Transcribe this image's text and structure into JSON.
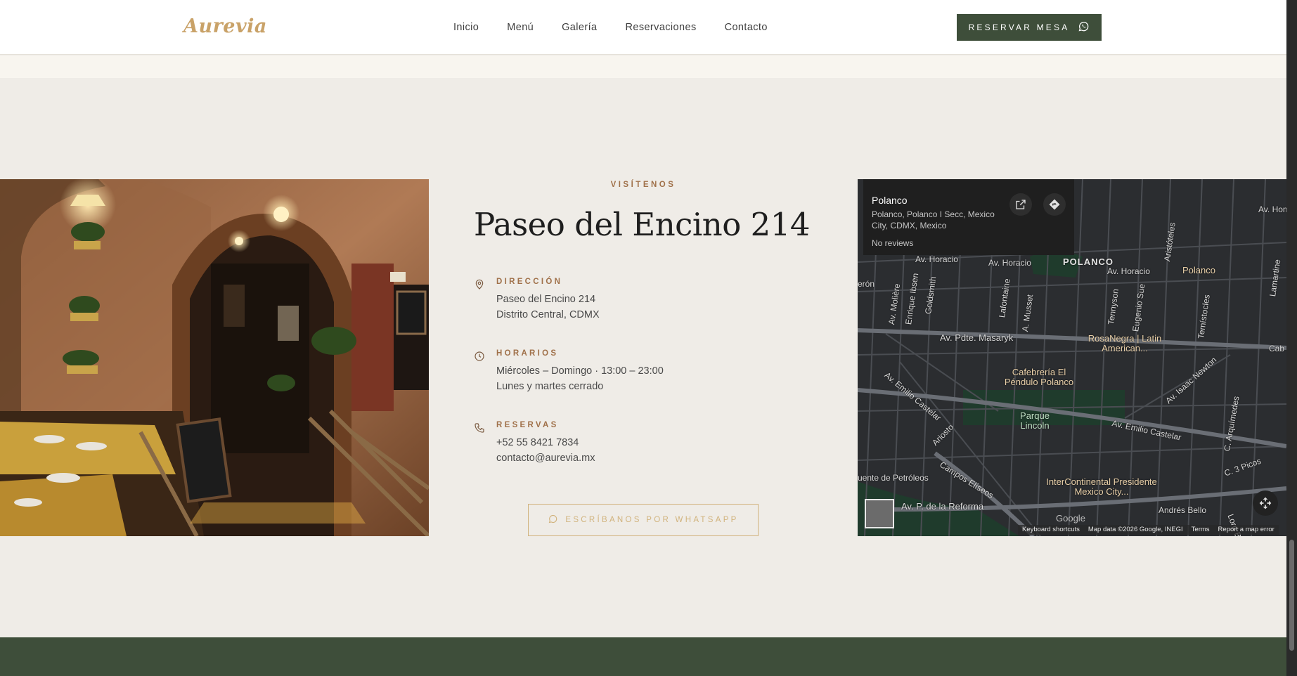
{
  "header": {
    "logo": "Aurevia",
    "nav": [
      "Inicio",
      "Menú",
      "Galería",
      "Reservaciones",
      "Contacto"
    ],
    "cta_label": "RESERVAR MESA"
  },
  "visit": {
    "eyebrow": "VISÍTENOS",
    "title": "Paseo del Encino 214",
    "direccion": {
      "label": "DIRECCIÓN",
      "lines": [
        "Paseo del Encino 214",
        "Distrito Central, CDMX"
      ]
    },
    "horarios": {
      "label": "HORARIOS",
      "lines": [
        "Miércoles – Domingo · 13:00 – 23:00",
        "Lunes y martes cerrado"
      ]
    },
    "reservas": {
      "label": "RESERVAS",
      "lines": [
        "+52 55 8421 7834",
        "contacto@aurevia.mx"
      ]
    },
    "whatsapp_button": "ESCRÍBANOS POR WHATSAPP"
  },
  "map": {
    "place_name": "Polanco",
    "place_address": "Polanco, Polanco I Secc, Mexico City, CDMX, Mexico",
    "reviews": "No reviews",
    "labels": {
      "av_horacio_1": "Av. Horacio",
      "av_horacio_2": "Av. Horacio",
      "av_horacio_3": "Av. Horacio",
      "polanco_area": "POLANCO",
      "polanco_poi": "Polanco",
      "masaryk": "Av. Pdte. Masaryk",
      "castelar_1": "Av. Emilio Castelar",
      "castelar_2": "Av. Emilio Castelar",
      "rosanegra": "RosaNegra | Latin American...",
      "cafeteria": "Cafebrería El Péndulo Polanco",
      "parque": "Parque Lincoln",
      "intercontinental": "InterContinental Presidente Mexico City...",
      "reforma": "Av. P. de la Reforma",
      "campos": "Campos Elíseos",
      "petroleos": "uente de Petróleos",
      "isaac_newton": "Av. Isaac Newton",
      "arquimedes": "C. Arquímedes",
      "picos": "C. 3 Picos",
      "andres_bello": "Andrés Bello",
      "molière": "Av. Molière",
      "enrique_ibsen": "Enrique Ibsen",
      "goldsmith": "Goldsmith",
      "lafontaine": "Lafontaine",
      "musset": "A. Musset",
      "tennyson": "Tennyson",
      "eugenio_sue": "Eugenio Sue",
      "temistocles": "Temístocles",
      "aristoteles": "Aristóteles",
      "ariosto": "Ariosto",
      "av_hom": "Av. Hom",
      "lamartine": "Lamartine",
      "lord_byron": "Lord Byron",
      "eron": "erón",
      "cab": "Cab"
    },
    "google": "Google",
    "footer": [
      "Keyboard shortcuts",
      "Map data ©2026 Google, INEGI",
      "Terms",
      "Report a map error"
    ]
  }
}
